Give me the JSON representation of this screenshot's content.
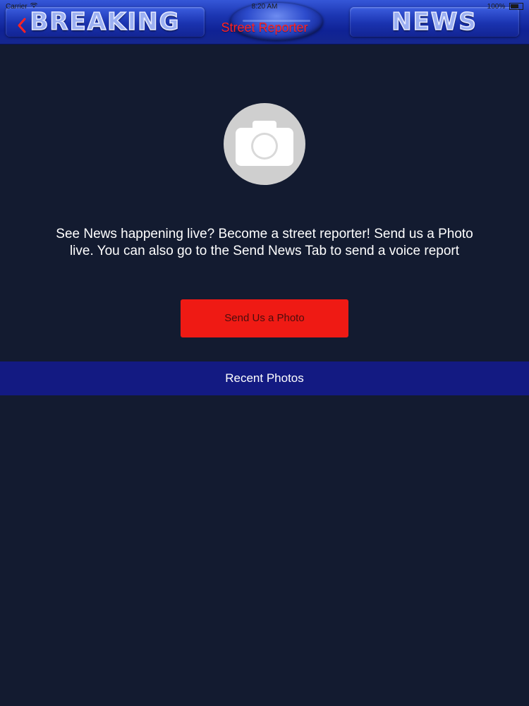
{
  "status_bar": {
    "carrier": "Carrier",
    "time": "8:20 AM",
    "battery": "100%"
  },
  "banner": {
    "word_left": "BREAKING",
    "word_right": "NEWS"
  },
  "nav": {
    "back_icon": "chevron-left-icon",
    "title": "Street Reporter",
    "title_color": "#ff2222"
  },
  "main": {
    "camera_icon": "camera-icon",
    "description": "See News happening live? Become a street reporter! Send us a Photo live. You can also go to the Send News Tab to send a voice report",
    "send_button_label": "Send Us a Photo",
    "send_button_color": "#ef1a14"
  },
  "recent": {
    "header": "Recent Photos",
    "header_color": "#131a82",
    "photos": []
  },
  "theme": {
    "background": "#131b30",
    "banner_blue": "#1c36b2"
  }
}
